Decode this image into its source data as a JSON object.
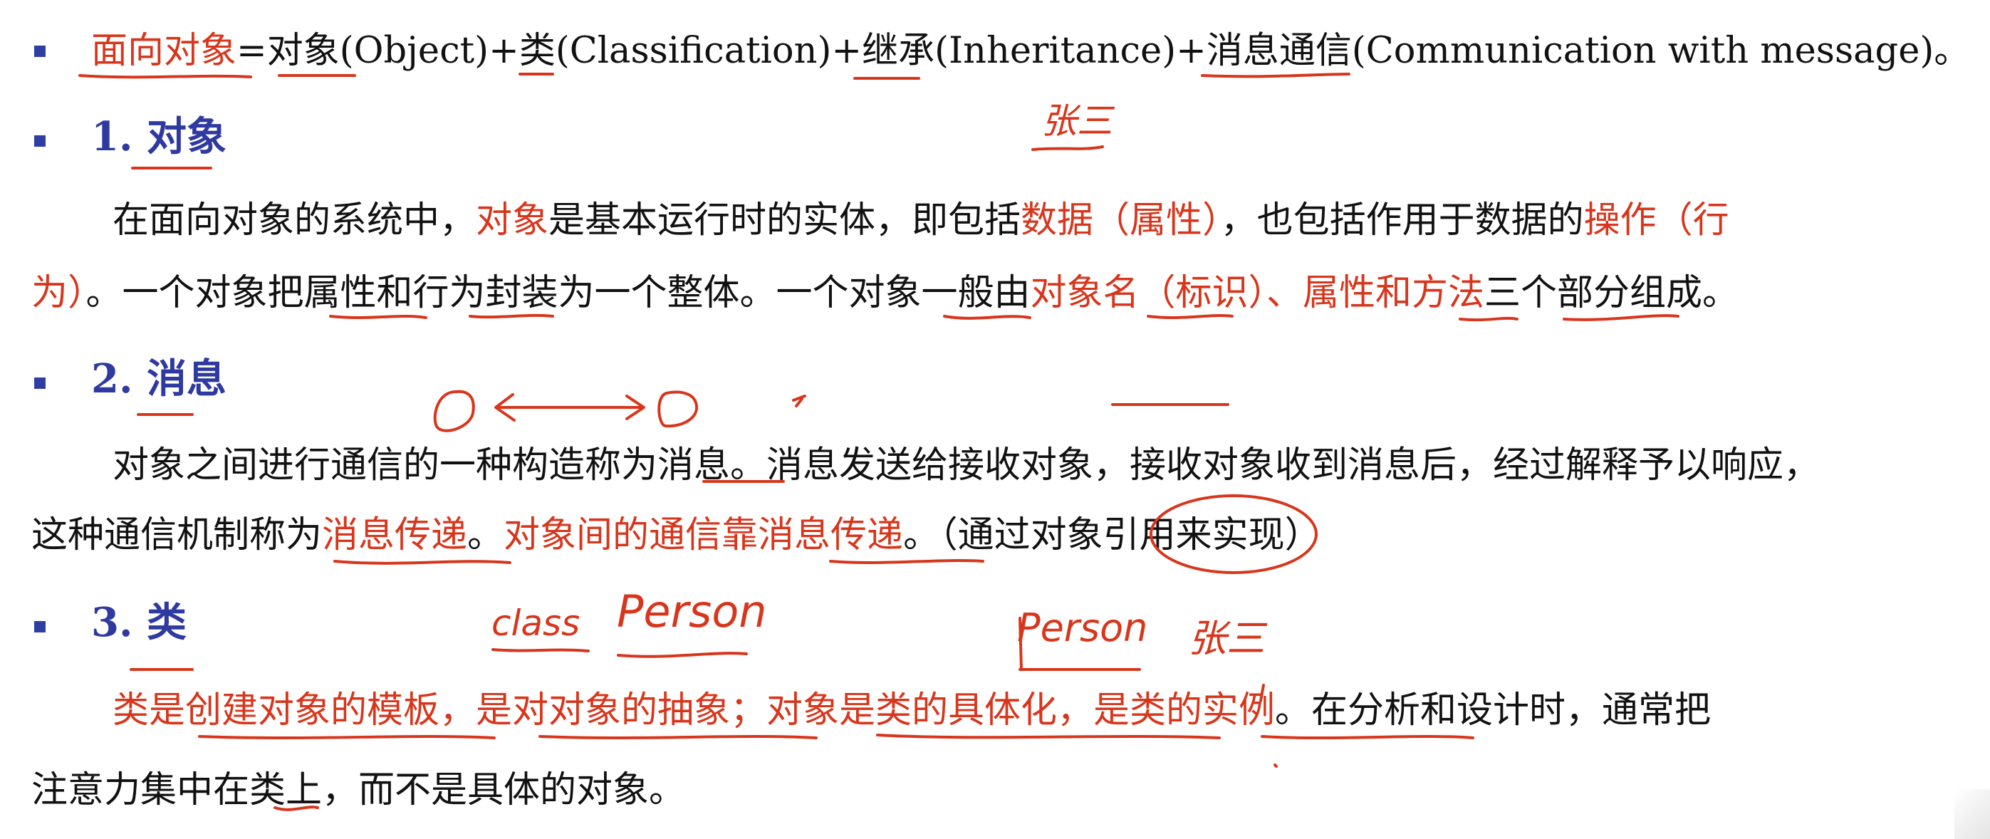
{
  "line1": {
    "a": "面向对象",
    "b": "=",
    "c": "对象",
    "d": "(Object)+",
    "e": "类",
    "f": "(Classification)+",
    "g": "继承",
    "h": "(Inheritance)+",
    "i": "消息通信",
    "j": "(Communication with message)。"
  },
  "section1": {
    "num": "1.",
    "title": "对象",
    "p1": {
      "a": "在面向对象的系统中，",
      "b": "对象",
      "c": "是基本运行时的实体，即包括",
      "d": "数据（属性）",
      "e": "，也包括作用于数据的",
      "f": "操作（行"
    },
    "p2": {
      "a": "为）",
      "b": "。一个对象把属性和行为封装为一个整体。一个对象一般由",
      "c": "对象名（标识）、属性和方法",
      "d": "三个部分组成。"
    }
  },
  "section2": {
    "num": "2.",
    "title": "消息",
    "p1": "对象之间进行通信的一种构造称为消息。消息发送给接收对象，接收对象收到消息后，经过解释予以响应，",
    "p2": {
      "a": "这种通信机制称为",
      "b": "消息传递",
      "c": "。",
      "d": "对象间的通信靠消息传递",
      "e": "。（通过对象引用来实现）"
    }
  },
  "section3": {
    "num": "3.",
    "title": "类",
    "p1": {
      "a": "类是创建对象的模板，是对对象的抽象；对象是类的具体化，是类的实例",
      "b": "。在分析和设计时，通常把"
    },
    "p2": "注意力集中在类上，而不是具体的对象。"
  },
  "handwriting": {
    "zhang_top": "张三",
    "class_word": "class",
    "person1": "Person",
    "person2": "Person",
    "zhang_bottom": "张三"
  },
  "colors": {
    "heading": "#2f3aa0",
    "highlight": "#d8361c",
    "bullet": "#2e3ea3",
    "text": "#111111"
  }
}
